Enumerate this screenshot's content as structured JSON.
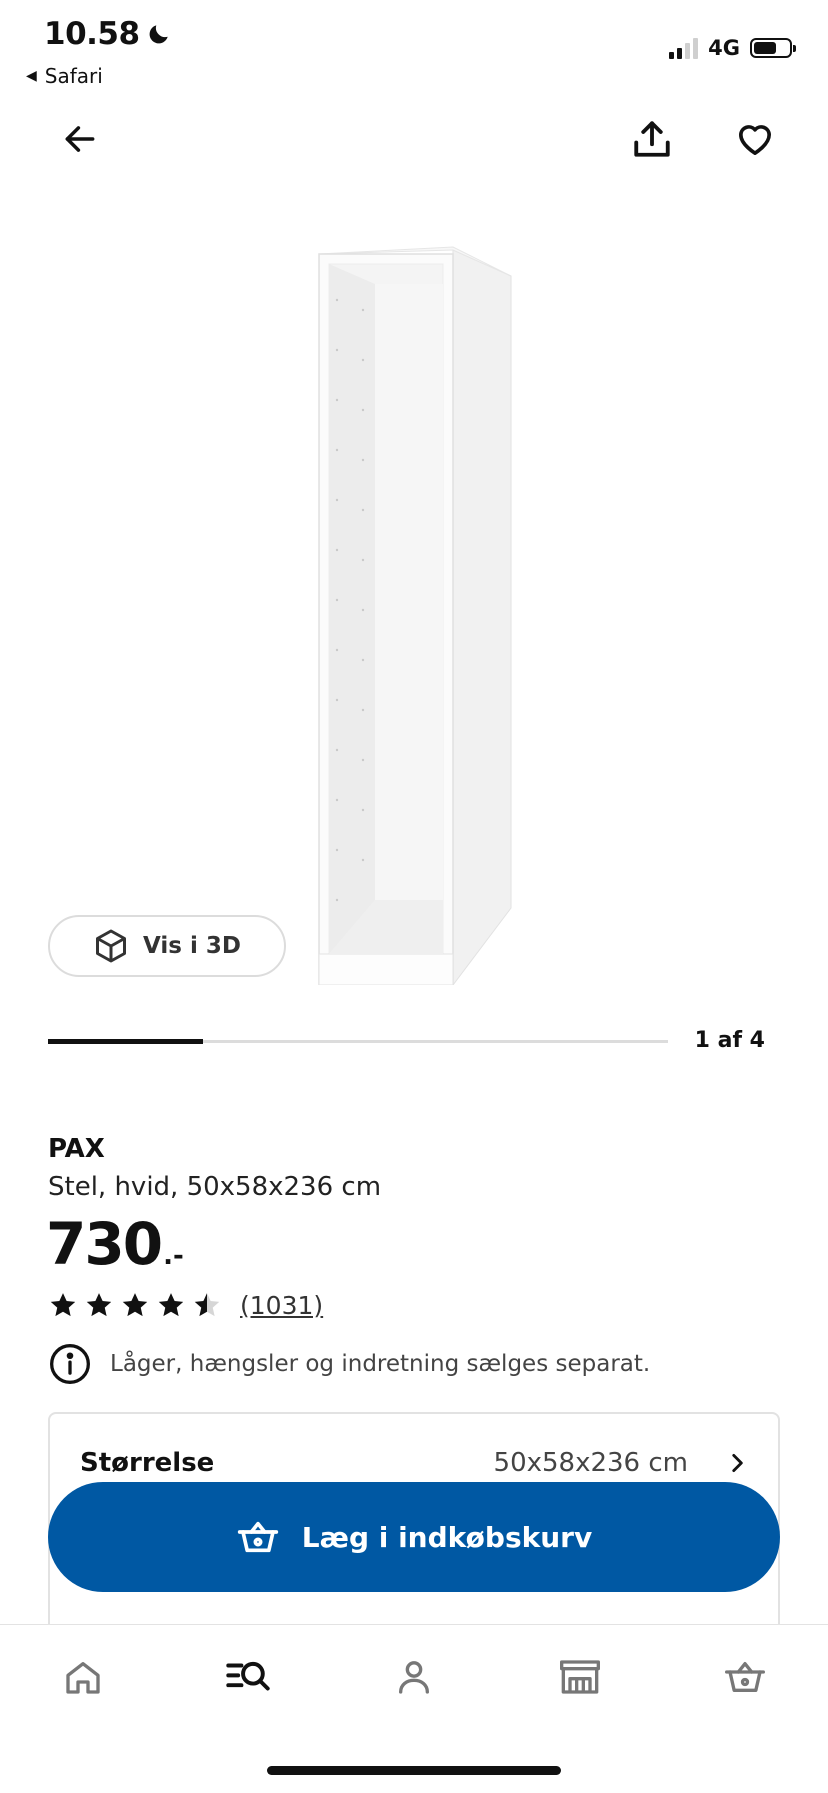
{
  "status_bar": {
    "time": "10.58",
    "back_app": "Safari",
    "network": "4G",
    "battery_level": 0.65
  },
  "header": {
    "back_icon": "arrow-left-icon",
    "share_icon": "share-icon",
    "favorite_icon": "heart-icon"
  },
  "gallery": {
    "view_3d_label": "Vis i 3D",
    "page_indicator": "1 af 4",
    "current_image": 1,
    "total_images": 4
  },
  "product": {
    "name": "PAX",
    "description": "Stel, hvid, 50x58x236 cm",
    "price": "730",
    "price_suffix": ".-",
    "rating": 4.5,
    "review_count": "(1031)",
    "notice": "Låger, hængsler og indretning sælges separat."
  },
  "options": {
    "size_label": "Størrelse",
    "size_value": "50x58x236 cm"
  },
  "cart": {
    "add_label": "Læg i indkøbskurv",
    "color": "#0058a3"
  },
  "bottom_nav": {
    "items": [
      "home-icon",
      "search-icon",
      "profile-icon",
      "store-icon",
      "basket-icon"
    ],
    "active": "search-icon"
  }
}
